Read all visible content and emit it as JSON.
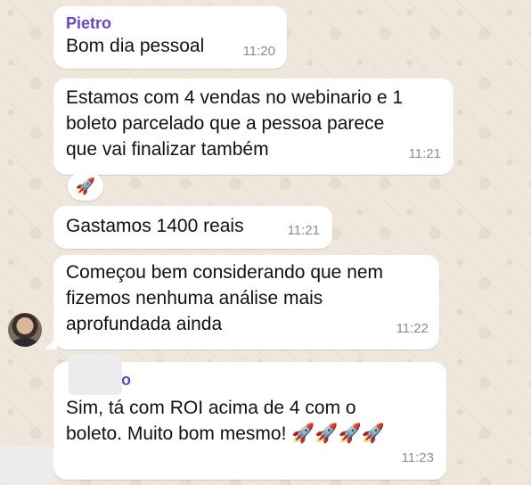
{
  "chat": {
    "messages": [
      {
        "sender": "Pietro",
        "text": "Bom dia pessoal",
        "time": "11:20"
      },
      {
        "text": "Estamos com 4 vendas no webinario e 1\nboleto parcelado que a pessoa parece\nque vai finalizar também",
        "time": "11:21",
        "reaction": "🚀"
      },
      {
        "text": "Gastamos 1400 reais",
        "time": "11:21"
      },
      {
        "text": "Começou bem considerando que nem\nfizemos nenhuma análise mais\naprofundada ainda",
        "time": "11:22"
      },
      {
        "sender_partial": "o",
        "text": "Sim, tá com ROI acima de 4 com o\nboleto. Muito bom mesmo! 🚀🚀🚀🚀",
        "time": "11:23"
      }
    ]
  },
  "colors": {
    "sender_name": "#6b45c9",
    "bubble": "#ffffff",
    "wallpaper": "#efe7dc",
    "timestamp": "#8c8c8c"
  }
}
